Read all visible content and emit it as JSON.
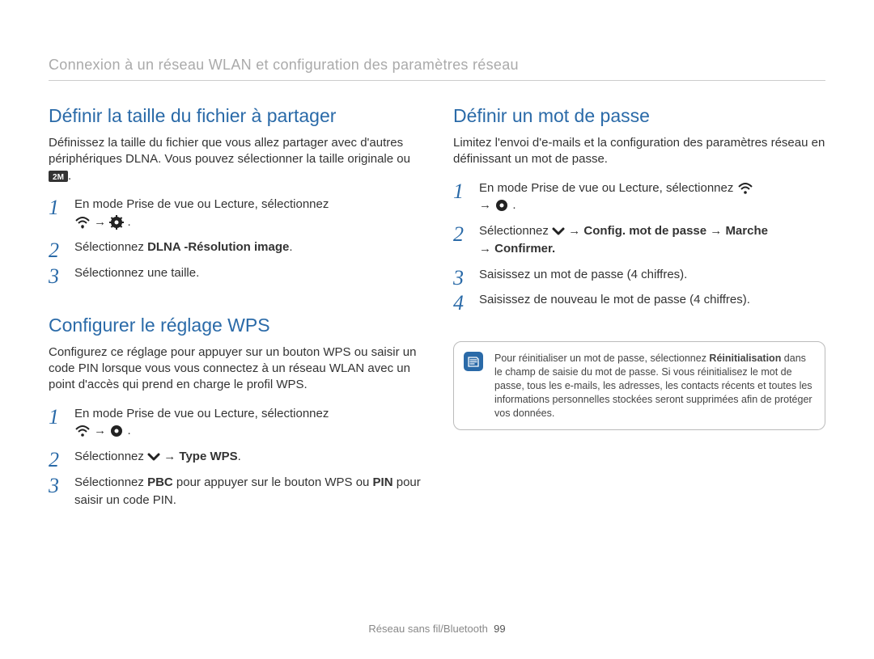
{
  "header": {
    "breadcrumb": "Connexion à un réseau WLAN et configuration des paramètres réseau"
  },
  "left": {
    "sec1": {
      "title": "Définir la taille du fichier à partager",
      "intro_part1": "Définissez la taille du fichier que vous allez partager avec d'autres périphériques DLNA. Vous pouvez sélectionner la taille originale ou ",
      "intro_part2": ".",
      "steps": {
        "s1a": "En mode Prise de vue ou Lecture, sélectionnez ",
        "s1b": " → ",
        "s1c": ".",
        "s2a": "Sélectionnez ",
        "s2b": "DLNA -Résolution image",
        "s2c": ".",
        "s3": "Sélectionnez une taille."
      }
    },
    "sec2": {
      "title": "Configurer le réglage WPS",
      "intro": "Configurez ce réglage pour appuyer sur un bouton WPS ou saisir un code PIN lorsque vous vous connectez à un réseau WLAN avec un point d'accès qui prend en charge le profil WPS.",
      "steps": {
        "s1a": "En mode Prise de vue ou Lecture, sélectionnez ",
        "s1b": " → ",
        "s1c": ".",
        "s2a": "Sélectionnez ",
        "s2b": " → ",
        "s2c": "Type WPS",
        "s2d": ".",
        "s3a": "Sélectionnez ",
        "s3b": "PBC",
        "s3c": " pour appuyer sur le bouton WPS ou ",
        "s3d": "PIN",
        "s3e": " pour saisir un code PIN."
      }
    }
  },
  "right": {
    "sec1": {
      "title": "Définir un mot de passe",
      "intro": "Limitez l'envoi d'e-mails et la configuration des paramètres réseau en définissant un mot de passe.",
      "steps": {
        "s1a": "En mode Prise de vue ou Lecture, sélectionnez ",
        "s1b": " → ",
        "s1c": ".",
        "s2a": "Sélectionnez ",
        "s2b": " → ",
        "s2c": "Config. mot de passe",
        "s2d": " → ",
        "s2e": "Marche",
        "s2f": " → ",
        "s2g": "Confirmer.",
        "s3": "Saisissez un mot de passe (4 chiffres).",
        "s4": "Saisissez de nouveau le mot de passe (4 chiffres)."
      },
      "note_a": "Pour réinitialiser un mot de passe, sélectionnez ",
      "note_b": "Réinitialisation",
      "note_c": " dans le champ de saisie du mot de passe. Si vous réinitialisez le mot de passe, tous les e-mails, les adresses, les contacts récents et toutes les informations personnelles stockées seront supprimées afin de protéger vos données."
    }
  },
  "footer": {
    "section": "Réseau sans fil/Bluetooth",
    "page": "99"
  },
  "icons": {
    "wifi": "wifi-icon",
    "gear": "gear-icon",
    "twom": "2m-size-icon",
    "down": "chevron-down-icon",
    "note": "note-icon"
  }
}
